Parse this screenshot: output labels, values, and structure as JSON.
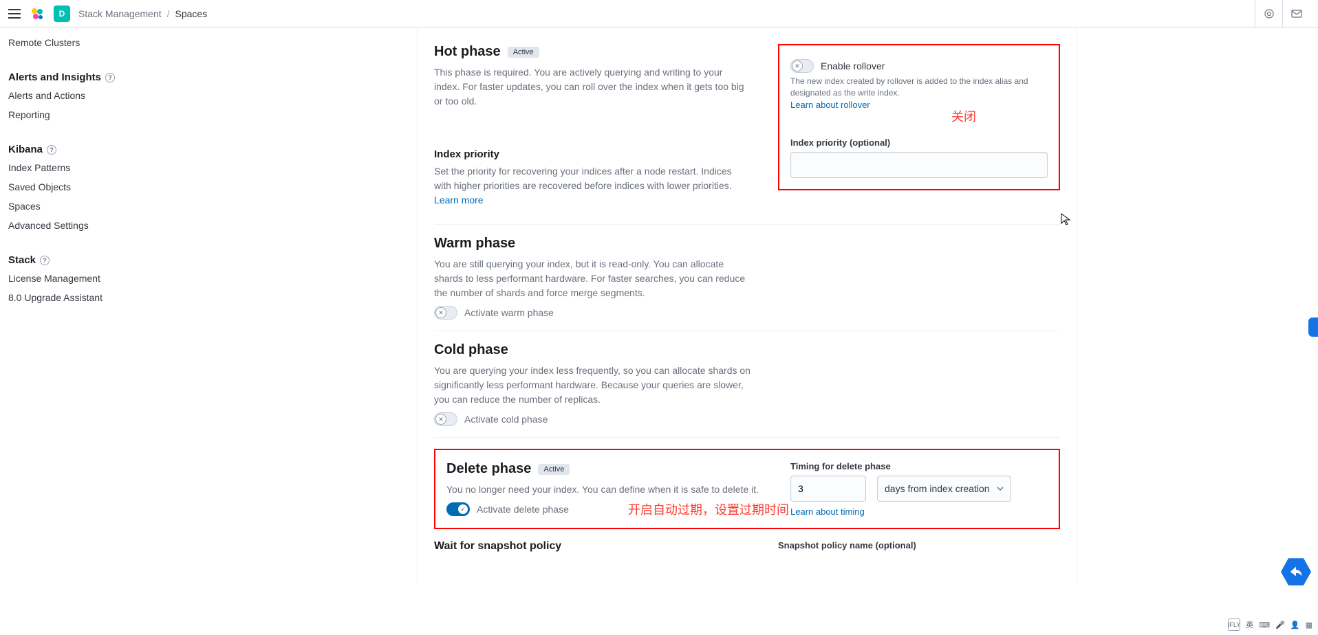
{
  "header": {
    "space_letter": "D",
    "breadcrumb_parent": "Stack Management",
    "breadcrumb_current": "Spaces"
  },
  "sidebar": {
    "remote_clusters": "Remote Clusters",
    "sections": [
      {
        "title": "Alerts and Insights",
        "items": [
          "Alerts and Actions",
          "Reporting"
        ]
      },
      {
        "title": "Kibana",
        "items": [
          "Index Patterns",
          "Saved Objects",
          "Spaces",
          "Advanced Settings"
        ]
      },
      {
        "title": "Stack",
        "items": [
          "License Management",
          "8.0 Upgrade Assistant"
        ]
      }
    ]
  },
  "hot": {
    "title": "Hot phase",
    "badge": "Active",
    "desc": "This phase is required. You are actively querying and writing to your index. For faster updates, you can roll over the index when it gets too big or too old.",
    "index_priority_title": "Index priority",
    "index_priority_desc": "Set the priority for recovering your indices after a node restart. Indices with higher priorities are recovered before indices with lower priorities. ",
    "learn_more": "Learn more",
    "rollover_label": "Enable rollover",
    "rollover_help": "The new index created by rollover is added to the index alias and designated as the write index.",
    "rollover_link": "Learn about rollover",
    "annotation": "关闭",
    "ip_field_label": "Index priority (optional)",
    "ip_value": ""
  },
  "warm": {
    "title": "Warm phase",
    "desc": "You are still querying your index, but it is read-only. You can allocate shards to less performant hardware. For faster searches, you can reduce the number of shards and force merge segments.",
    "switch_label": "Activate warm phase"
  },
  "cold": {
    "title": "Cold phase",
    "desc": "You are querying your index less frequently, so you can allocate shards on significantly less performant hardware. Because your queries are slower, you can reduce the number of replicas.",
    "switch_label": "Activate cold phase"
  },
  "del": {
    "title": "Delete phase",
    "badge": "Active",
    "desc": "You no longer need your index. You can define when it is safe to delete it.",
    "switch_label": "Activate delete phase",
    "annotation": "开启自动过期，设置过期时间",
    "timing_label": "Timing for delete phase",
    "timing_value": "3",
    "timing_unit": "days from index creation",
    "timing_link": "Learn about timing"
  },
  "snapshot": {
    "title": "Wait for snapshot policy",
    "field_label": "Snapshot policy name (optional)"
  },
  "os": {
    "ime1": "iFLY",
    "ime2": "英"
  }
}
